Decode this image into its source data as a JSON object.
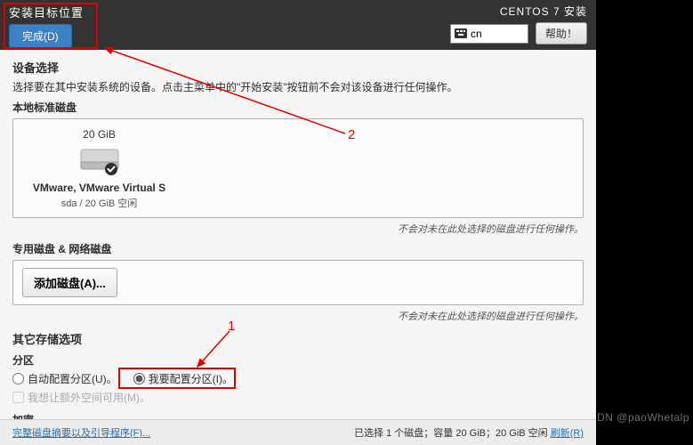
{
  "header": {
    "title": "安装目标位置",
    "done": "完成(D)",
    "install_title": "CENTOS 7 安装",
    "lang": "cn",
    "help": "帮助！"
  },
  "device": {
    "title": "设备选择",
    "desc": "选择要在其中安装系统的设备。点击主菜单中的\"开始安装\"按钮前不会对该设备进行任何操作。",
    "local_title": "本地标准磁盘",
    "disk": {
      "size": "20 GiB",
      "name": "VMware, VMware Virtual S",
      "sub": "sda   /   20 GiB 空闲"
    },
    "note": "不会对未在此处选择的磁盘进行任何操作。",
    "special_title": "专用磁盘 & 网络磁盘",
    "add_disk": "添加磁盘(A)..."
  },
  "storage": {
    "title": "其它存储选项",
    "part_label": "分区",
    "auto": "自动配置分区(U)。",
    "manual": "我要配置分区(I)。",
    "extra": "我想让额外空间可用(M)。",
    "encrypt_title": "加密"
  },
  "footer": {
    "summary": "完整磁盘摘要以及引导程序(F)...",
    "status_prefix": "已选择 1 个磁盘；容量 20 GiB；20 GiB 空闲 ",
    "refresh": "刷新(R)"
  },
  "annot": {
    "one": "1",
    "two": "2"
  },
  "watermark": "DN @paoWhetalp"
}
